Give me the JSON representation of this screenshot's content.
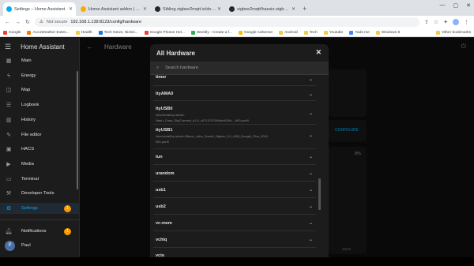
{
  "browser": {
    "tabs": [
      {
        "title": "Settings – Home Assistant",
        "color": "#03a9f4"
      },
      {
        "title": "Home Assistant addon | Zigbee...",
        "color": "#f9ab00"
      },
      {
        "title": "Sibling zigbee2mqtt.io/docs/gu...",
        "color": "#24292e"
      },
      {
        "title": "zigbee2mqtt/hassio-zigbee2mq...",
        "color": "#24292e"
      }
    ],
    "new_tab": "+",
    "url_prefix": "Not secure",
    "url": "192.168.1.139:8123/config/hardware",
    "bookmarks": [
      "Google",
      "AccuWeather Exten...",
      "Health",
      "Tech News, Nicksi...",
      "Google Photos Hel...",
      "Weebly - Create a f...",
      "Google AdSense",
      "Android",
      "Tech",
      "Youtube",
      "Yadz.me",
      "Windows 8"
    ],
    "other_bookmarks": "Other bookmarks"
  },
  "sidebar": {
    "title": "Home Assistant",
    "items": [
      {
        "label": "Main",
        "icon": "grid-icon",
        "glyph": "▦"
      },
      {
        "label": "Energy",
        "icon": "bolt-icon",
        "glyph": "ϟ"
      },
      {
        "label": "Map",
        "icon": "map-icon",
        "glyph": "◫"
      },
      {
        "label": "Logbook",
        "icon": "logbook-icon",
        "glyph": "☰"
      },
      {
        "label": "History",
        "icon": "history-icon",
        "glyph": "▥"
      },
      {
        "label": "File editor",
        "icon": "wrench-icon",
        "glyph": "✎"
      },
      {
        "label": "HACS",
        "icon": "hacs-icon",
        "glyph": "▣"
      },
      {
        "label": "Media",
        "icon": "media-icon",
        "glyph": "▶"
      },
      {
        "label": "Terminal",
        "icon": "terminal-icon",
        "glyph": "▭"
      },
      {
        "label": "Developer Tools",
        "icon": "hammer-icon",
        "glyph": "⚒"
      },
      {
        "label": "Settings",
        "icon": "gear-icon",
        "glyph": "⚙",
        "badge": "1"
      }
    ],
    "notifications": {
      "label": "Notifications",
      "badge": "1"
    },
    "user": {
      "initial": "P",
      "name": "Paul"
    }
  },
  "page": {
    "title": "Hardware",
    "configure": "CONFIGURE",
    "percent": "8%",
    "time_label": "18:01"
  },
  "dialog": {
    "title": "All Hardware",
    "close": "✕",
    "search_placeholder": "Search hardware",
    "rows": [
      {
        "name": "timer"
      },
      {
        "name": "ttyAMA0"
      },
      {
        "name": "ttyUSB0",
        "sub": [
          "/dev/serial/by-id/usb-",
          "Nabu_Casa_SkyConnect_v1.0_c4714747694ded119b...-if00-port0"
        ]
      },
      {
        "name": "ttyUSB1",
        "sub": [
          "/dev/serial/by-id/usb-Silicon_Labs_Sonoff_Zigbee_3.0_USB_Dongle_Plus_0001-",
          "if00-port0"
        ]
      },
      {
        "name": "tun"
      },
      {
        "name": "urandom"
      },
      {
        "name": "usb1"
      },
      {
        "name": "usb2"
      },
      {
        "name": "vc-mem"
      },
      {
        "name": "vchiq"
      },
      {
        "name": "vcio"
      }
    ]
  },
  "colors": {
    "accent": "#03a9f4",
    "badge": "#ff9800"
  }
}
